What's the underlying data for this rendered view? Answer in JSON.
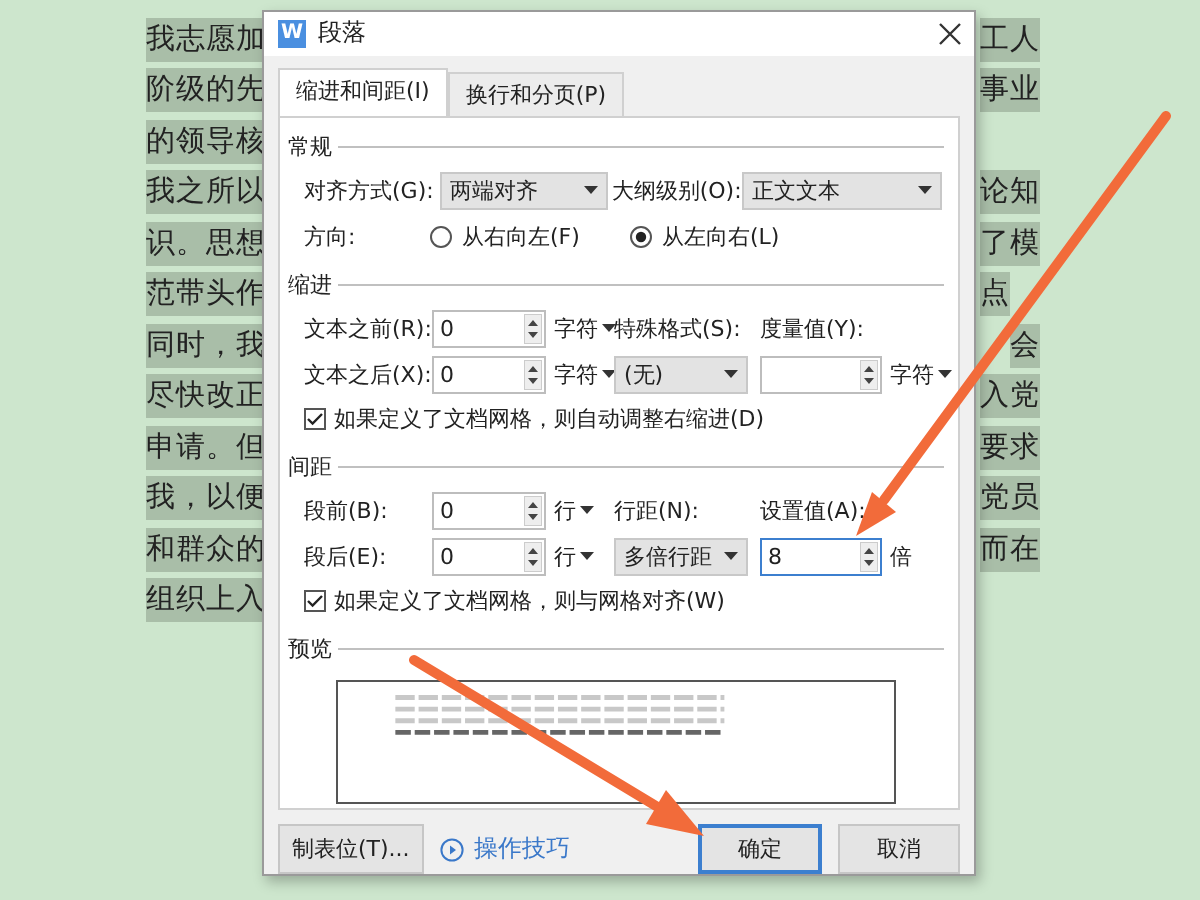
{
  "document": {
    "lines": [
      {
        "left": "我志愿加",
        "right": "工人"
      },
      {
        "left": "阶级的先",
        "right": "事业"
      },
      {
        "left": "的领导核"
      },
      {
        "left": "我之所以",
        "right": "论知"
      },
      {
        "left": "识。思想",
        "right": "了模"
      },
      {
        "left": "范带头作",
        "right": "点"
      },
      {
        "left": "同时，我",
        "right": "会"
      },
      {
        "left": "尽快改正",
        "right": "入党"
      },
      {
        "left": "申请。但",
        "right": "要求"
      },
      {
        "left": "我，以便",
        "right": "党员"
      },
      {
        "left": "和群众的",
        "right": "而在"
      },
      {
        "left": "组织上入"
      }
    ]
  },
  "dialog": {
    "icon_letter": "W",
    "title": "段落",
    "tabs": [
      {
        "label": "缩进和间距(I)",
        "selected": true
      },
      {
        "label": "换行和分页(P)",
        "selected": false
      }
    ],
    "general": {
      "heading": "常规",
      "alignment": {
        "label": "对齐方式(G):",
        "value": "两端对齐"
      },
      "outline_level": {
        "label": "大纲级别(O):",
        "value": "正文文本"
      },
      "direction": {
        "label": "方向:",
        "options": [
          {
            "label": "从右向左(F)",
            "selected": false
          },
          {
            "label": "从左向右(L)",
            "selected": true
          }
        ]
      }
    },
    "indent": {
      "heading": "缩进",
      "before": {
        "label": "文本之前(R):",
        "value": "0",
        "unit": "字符"
      },
      "after": {
        "label": "文本之后(X):",
        "value": "0",
        "unit": "字符"
      },
      "special": {
        "label": "特殊格式(S):",
        "value": "(无)"
      },
      "measure": {
        "label": "度量值(Y):",
        "unit": "字符"
      },
      "auto_adjust": {
        "label": "如果定义了文档网格，则自动调整右缩进(D)",
        "checked": true
      }
    },
    "spacing": {
      "heading": "间距",
      "before": {
        "label": "段前(B):",
        "value": "0",
        "unit": "行"
      },
      "after": {
        "label": "段后(E):",
        "value": "0",
        "unit": "行"
      },
      "line_spacing": {
        "label": "行距(N):",
        "value": "多倍行距"
      },
      "set_value": {
        "label": "设置值(A):",
        "value": "8",
        "unit": "倍"
      },
      "snap_grid": {
        "label": "如果定义了文档网格，则与网格对齐(W)",
        "checked": true
      }
    },
    "preview": {
      "heading": "预览"
    },
    "buttons": {
      "tabs": "制表位(T)...",
      "tips": "操作技巧",
      "ok": "确定",
      "cancel": "取消"
    }
  }
}
